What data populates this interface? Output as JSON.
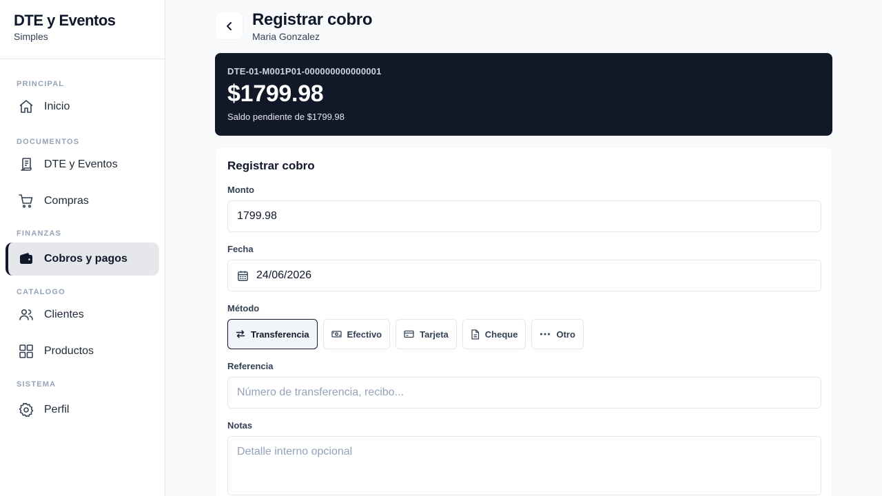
{
  "sidebar": {
    "brand_title": "DTE y Eventos",
    "brand_subtitle": "Simples",
    "sections": {
      "principal": "PRINCIPAL",
      "documentos": "DOCUMENTOS",
      "finanzas": "FINANZAS",
      "catalogo": "CATALOGO",
      "sistema": "SISTEMA"
    },
    "items": {
      "inicio": {
        "label": "Inicio",
        "icon": "home-icon"
      },
      "dte": {
        "label": "DTE y Eventos",
        "icon": "receipt-icon"
      },
      "compras": {
        "label": "Compras",
        "icon": "cart-icon"
      },
      "cobros": {
        "label": "Cobros y pagos",
        "icon": "wallet-icon",
        "active": true
      },
      "clientes": {
        "label": "Clientes",
        "icon": "users-icon"
      },
      "productos": {
        "label": "Productos",
        "icon": "grid-icon"
      },
      "perfil": {
        "label": "Perfil",
        "icon": "gear-icon"
      }
    }
  },
  "header": {
    "title": "Registrar cobro",
    "subtitle": "Maria Gonzalez"
  },
  "document": {
    "number": "DTE-01-M001P01-000000000000001",
    "amount": "$1799.98",
    "balance": "Saldo pendiente de $1799.98"
  },
  "form": {
    "title": "Registrar cobro",
    "amount_label": "Monto",
    "amount_value": "1799.98",
    "date_label": "Fecha",
    "date_value": "24/06/2026",
    "method_label": "Método",
    "methods": {
      "transferencia": {
        "label": "Transferencia",
        "icon": "swap-arrows-icon",
        "selected": true
      },
      "efectivo": {
        "label": "Efectivo",
        "icon": "cash-icon"
      },
      "tarjeta": {
        "label": "Tarjeta",
        "icon": "credit-card-icon"
      },
      "cheque": {
        "label": "Cheque",
        "icon": "document-icon"
      },
      "otro": {
        "label": "Otro",
        "icon": "more-dots-icon"
      }
    },
    "reference_label": "Referencia",
    "reference_placeholder": "Número de transferencia, recibo...",
    "notes_label": "Notas",
    "notes_placeholder": "Detalle interno opcional"
  },
  "colors": {
    "accent_dark": "#111827",
    "active_nav_bg": "#e5e7eb",
    "border": "#e2e8f0",
    "muted_text": "#94a3b8"
  }
}
